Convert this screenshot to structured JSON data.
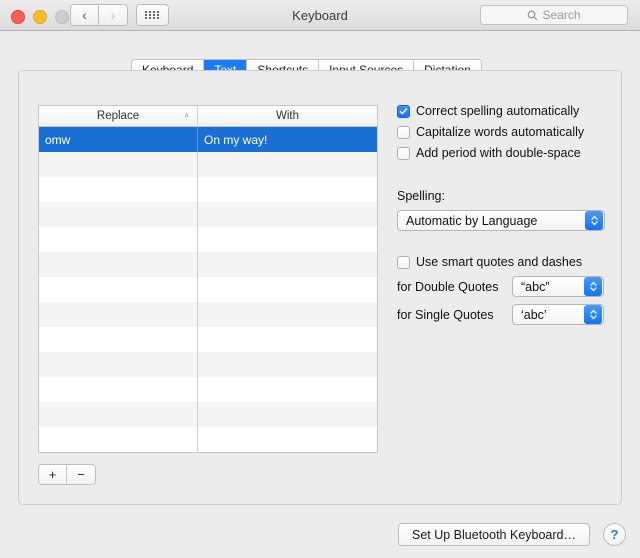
{
  "window": {
    "title": "Keyboard",
    "traffic_lights": [
      "close",
      "minimize",
      "zoom"
    ],
    "nav_back": "‹",
    "nav_forward": "›",
    "grid_button": "show-all-icon",
    "search": {
      "placeholder": "Search",
      "value": "",
      "icon": "search-icon"
    }
  },
  "tabs": [
    {
      "label": "Keyboard",
      "active": false
    },
    {
      "label": "Text",
      "active": true
    },
    {
      "label": "Shortcuts",
      "active": false
    },
    {
      "label": "Input Sources",
      "active": false
    },
    {
      "label": "Dictation",
      "active": false
    }
  ],
  "table": {
    "columns": [
      {
        "label": "Replace",
        "sort_indicator": "˄"
      },
      {
        "label": "With",
        "sort_indicator": ""
      }
    ],
    "rows": [
      {
        "replace": "omw",
        "with": "On my way!",
        "selected": true
      },
      {
        "replace": "",
        "with": "",
        "selected": false
      },
      {
        "replace": "",
        "with": "",
        "selected": false
      },
      {
        "replace": "",
        "with": "",
        "selected": false
      },
      {
        "replace": "",
        "with": "",
        "selected": false
      },
      {
        "replace": "",
        "with": "",
        "selected": false
      },
      {
        "replace": "",
        "with": "",
        "selected": false
      },
      {
        "replace": "",
        "with": "",
        "selected": false
      },
      {
        "replace": "",
        "with": "",
        "selected": false
      },
      {
        "replace": "",
        "with": "",
        "selected": false
      },
      {
        "replace": "",
        "with": "",
        "selected": false
      },
      {
        "replace": "",
        "with": "",
        "selected": false
      },
      {
        "replace": "",
        "with": "",
        "selected": false
      }
    ]
  },
  "add_remove": {
    "add_label": "+",
    "remove_label": "−"
  },
  "options": {
    "checkboxes": [
      {
        "label": "Correct spelling automatically",
        "checked": true
      },
      {
        "label": "Capitalize words automatically",
        "checked": false
      },
      {
        "label": "Add period with double-space",
        "checked": false
      }
    ],
    "spelling_label": "Spelling:",
    "spelling_value": "Automatic by Language",
    "smart_quotes": {
      "label": "Use smart quotes and dashes",
      "checked": false
    },
    "double_quotes_label": "for Double Quotes",
    "double_quotes_value": "“abc”",
    "single_quotes_label": "for Single Quotes",
    "single_quotes_value": "‘abc’"
  },
  "footer": {
    "bluetooth_button": "Set Up Bluetooth Keyboard…",
    "help_button": "?"
  },
  "colors": {
    "accent_blue": "#1a7cf5",
    "selection_blue": "#1a6fd4",
    "window_bg": "#ececec"
  }
}
